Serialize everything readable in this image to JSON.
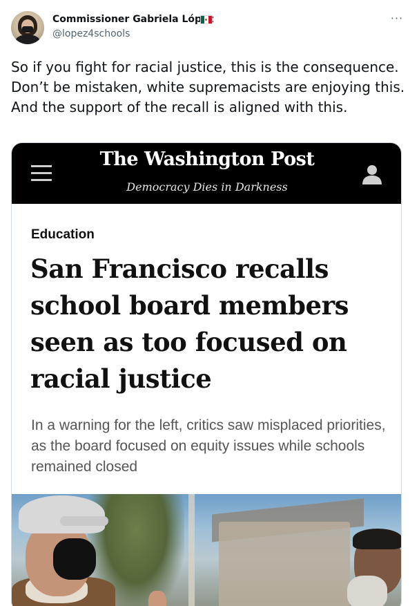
{
  "tweet": {
    "display_name": "Commissioner Gabriela López",
    "handle": "@lopez4schools",
    "more_label": "···",
    "text": "So if you fight for racial justice, this is the consequence. Don’t be mistaken, white supremacists are enjoying this. And the support of the recall is aligned with this."
  },
  "card": {
    "masthead": {
      "logo": "The Washington Post",
      "tagline": "Democracy Dies in Darkness"
    },
    "article": {
      "section": "Education",
      "headline": "San Francisco recalls school board members seen as too focused on racial justice",
      "subhead": "In a warning for the left, critics saw misplaced priorities, as the board focused on equity issues while schools remained closed"
    }
  },
  "icons": {
    "menu": "hamburger-menu-icon",
    "user": "user-icon",
    "more": "more-options-icon",
    "flag": "mexico-flag-icon"
  },
  "colors": {
    "masthead_bg": "#000000",
    "text_primary": "#0f1419",
    "text_secondary": "#536471",
    "border": "#cfd9de"
  }
}
